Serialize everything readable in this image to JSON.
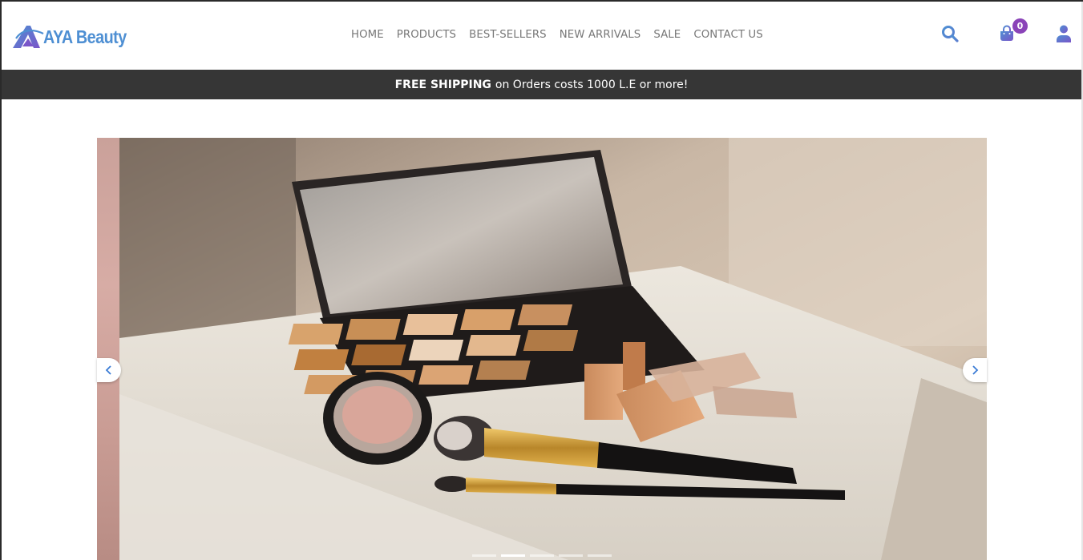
{
  "brand": {
    "logo_text": "AYA Beauty",
    "color": "#4e8fd3"
  },
  "nav": {
    "items": [
      {
        "label": "HOME"
      },
      {
        "label": "PRODUCTS"
      },
      {
        "label": "BEST-SELLERS"
      },
      {
        "label": "NEW ARRIVALS"
      },
      {
        "label": "SALE"
      },
      {
        "label": "CONTACT US"
      }
    ]
  },
  "header_icons": {
    "search": "search-icon",
    "cart": "shopping-bag-icon",
    "cart_count": "0",
    "user": "user-icon",
    "icon_gradient": [
      "#4e8fd3",
      "#8a43b8"
    ]
  },
  "shipping_bar": {
    "bold": "FREE SHIPPING",
    "text": "on Orders costs 1000 L.E or more!",
    "background": "#363636"
  },
  "carousel": {
    "slide_count": 5,
    "active_index": 1,
    "prev_icon": "chevron-left-icon",
    "next_icon": "chevron-right-icon",
    "image_subject": "makeup palette with brushes and lipsticks on white table"
  }
}
